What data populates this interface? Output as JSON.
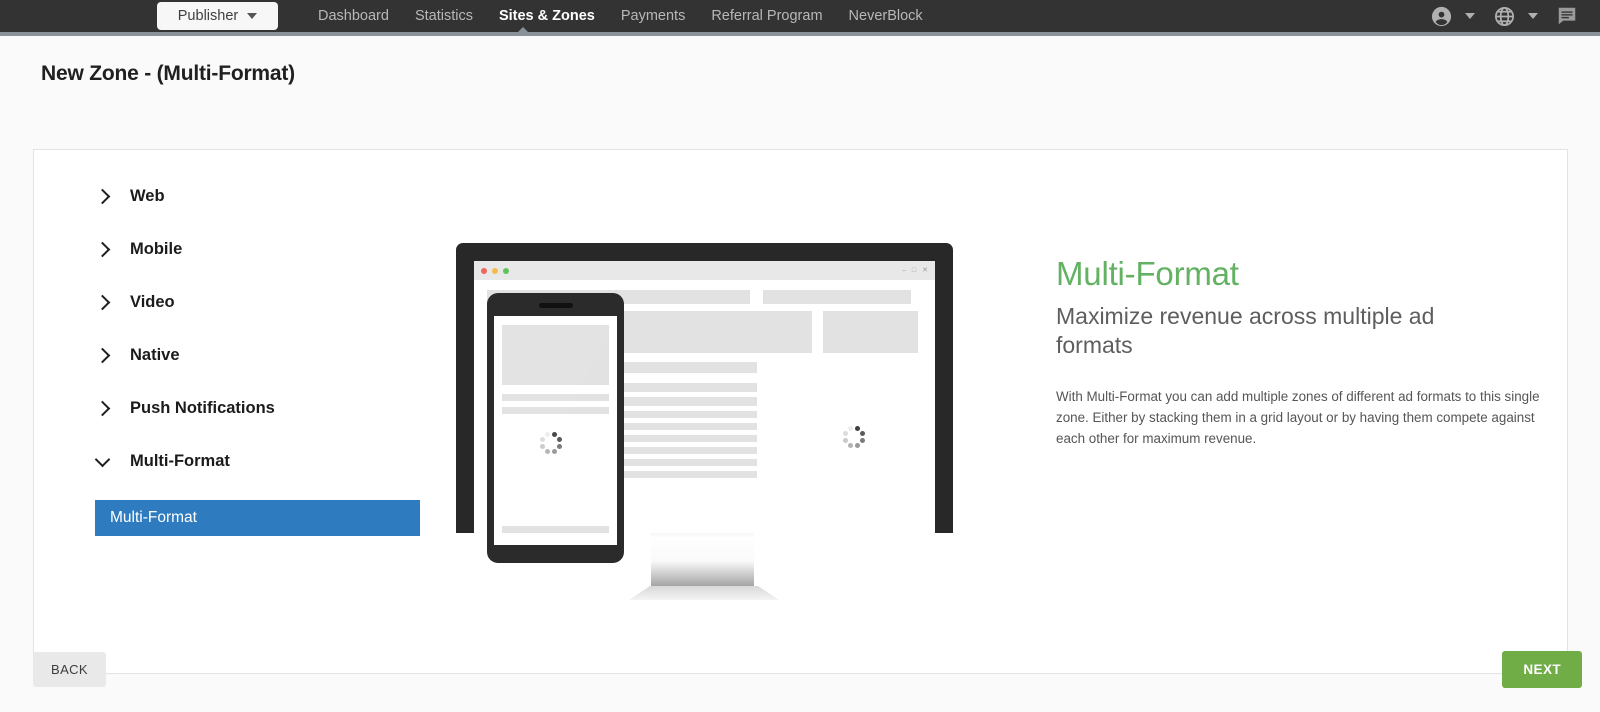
{
  "topnav": {
    "account_selector": {
      "label": "Publisher",
      "icon": "chevron-down-icon"
    },
    "tabs": [
      {
        "label": "Dashboard",
        "active": false
      },
      {
        "label": "Statistics",
        "active": false
      },
      {
        "label": "Sites & Zones",
        "active": true
      },
      {
        "label": "Payments",
        "active": false
      },
      {
        "label": "Referral Program",
        "active": false
      },
      {
        "label": "NeverBlock",
        "active": false
      }
    ],
    "right_icons": [
      {
        "name": "account-icon"
      },
      {
        "name": "chevron-down-icon"
      },
      {
        "name": "globe-icon"
      },
      {
        "name": "chevron-down-icon"
      },
      {
        "name": "chat-icon"
      }
    ]
  },
  "page": {
    "title": "New Zone - (Multi-Format)"
  },
  "format_list": {
    "items": [
      {
        "label": "Web",
        "expanded": false,
        "icon": "chevron-right-icon"
      },
      {
        "label": "Mobile",
        "expanded": false,
        "icon": "chevron-right-icon"
      },
      {
        "label": "Video",
        "expanded": false,
        "icon": "chevron-right-icon"
      },
      {
        "label": "Native",
        "expanded": false,
        "icon": "chevron-right-icon"
      },
      {
        "label": "Push Notifications",
        "expanded": false,
        "icon": "chevron-right-icon"
      },
      {
        "label": "Multi-Format",
        "expanded": true,
        "icon": "chevron-down-icon"
      }
    ],
    "selected_subitem": "Multi-Format"
  },
  "illustration": {
    "name": "multi-format-devices-illustration",
    "desktop_window_controls": [
      "minimize",
      "maximize",
      "close"
    ],
    "traffic_light_dots": [
      "red",
      "yellow",
      "green"
    ],
    "loading_spinner": "loading-spinner-icon"
  },
  "info": {
    "heading": "Multi-Format",
    "subheading": "Maximize revenue across multiple ad formats",
    "description": "With Multi-Format you can add multiple zones of different ad formats to this single zone. Either by stacking them in a grid layout or by having them compete against each other for maximum revenue."
  },
  "footer": {
    "back_label": "BACK",
    "next_label": "NEXT"
  },
  "colors": {
    "topbar_bg": "#333333",
    "topbar_border": "#8a9199",
    "accent_green": "#63b263",
    "next_button_green": "#70ad47",
    "selected_blue": "#2e7cbf",
    "page_bg": "#fafafa"
  }
}
